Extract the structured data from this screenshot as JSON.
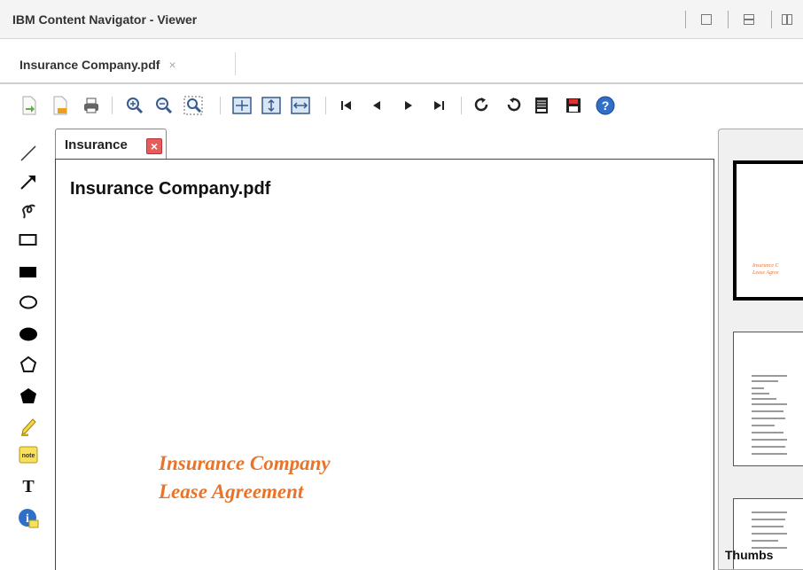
{
  "window": {
    "title": "IBM Content Navigator - Viewer"
  },
  "doc_tabs": [
    {
      "label": "Insurance Company.pdf",
      "close": "×"
    }
  ],
  "toolbar": {
    "icons": [
      "next-page-doc-icon",
      "prev-doc-icon",
      "print-icon",
      "zoom-in-icon",
      "zoom-out-icon",
      "zoom-area-icon",
      "fit-page-icon",
      "fit-height-icon",
      "fit-width-icon",
      "first-page-icon",
      "previous-page-icon",
      "next-page-icon",
      "last-page-icon",
      "rotate-right-icon",
      "rotate-left-icon",
      "document-properties-icon",
      "save-icon",
      "help-icon"
    ]
  },
  "palette": {
    "tools": [
      "line-icon",
      "arrow-icon",
      "freehand-icon",
      "rectangle-icon",
      "filled-rectangle-icon",
      "oval-icon",
      "filled-oval-icon",
      "polygon-icon",
      "filled-polygon-icon",
      "highlight-icon",
      "note-icon",
      "text-icon",
      "stamp-icon"
    ],
    "note_label": "note",
    "text_label": "T",
    "info_label": "i"
  },
  "viewer_tab": {
    "label": "Insurance",
    "close": "×"
  },
  "document": {
    "title": "Insurance Company.pdf",
    "cover_line1": "Insurance Company",
    "cover_line2": "Lease Agreement"
  },
  "thumbs_panel": {
    "label": "Thumbs"
  },
  "colors": {
    "accent_orange": "#e8742a",
    "close_red": "#e85b5b"
  }
}
